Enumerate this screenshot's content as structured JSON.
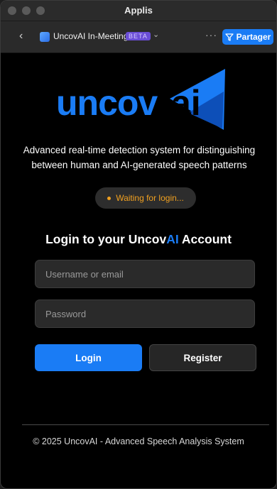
{
  "window": {
    "title": "Applis"
  },
  "toolbar": {
    "app_name": "UncovAI In-Meeting",
    "beta_label": "BETA",
    "share_label": "Partager"
  },
  "logo": {
    "text_left": "uncov",
    "text_right": "ai"
  },
  "tagline": {
    "line1": "Advanced real-time detection system for distinguishing",
    "line2": "between human and AI-generated speech patterns"
  },
  "status": {
    "text": "Waiting for login..."
  },
  "login": {
    "heading_prefix": "Login to your Uncov",
    "heading_accent": "AI",
    "heading_suffix": " Account",
    "username_placeholder": "Username or email",
    "password_placeholder": "Password",
    "login_label": "Login",
    "register_label": "Register"
  },
  "footer": {
    "text": "© 2025 UncovAI - Advanced Speech Analysis System"
  },
  "colors": {
    "accent": "#1a7cf5",
    "status": "#f0a020",
    "beta": "#6a4ed6"
  }
}
